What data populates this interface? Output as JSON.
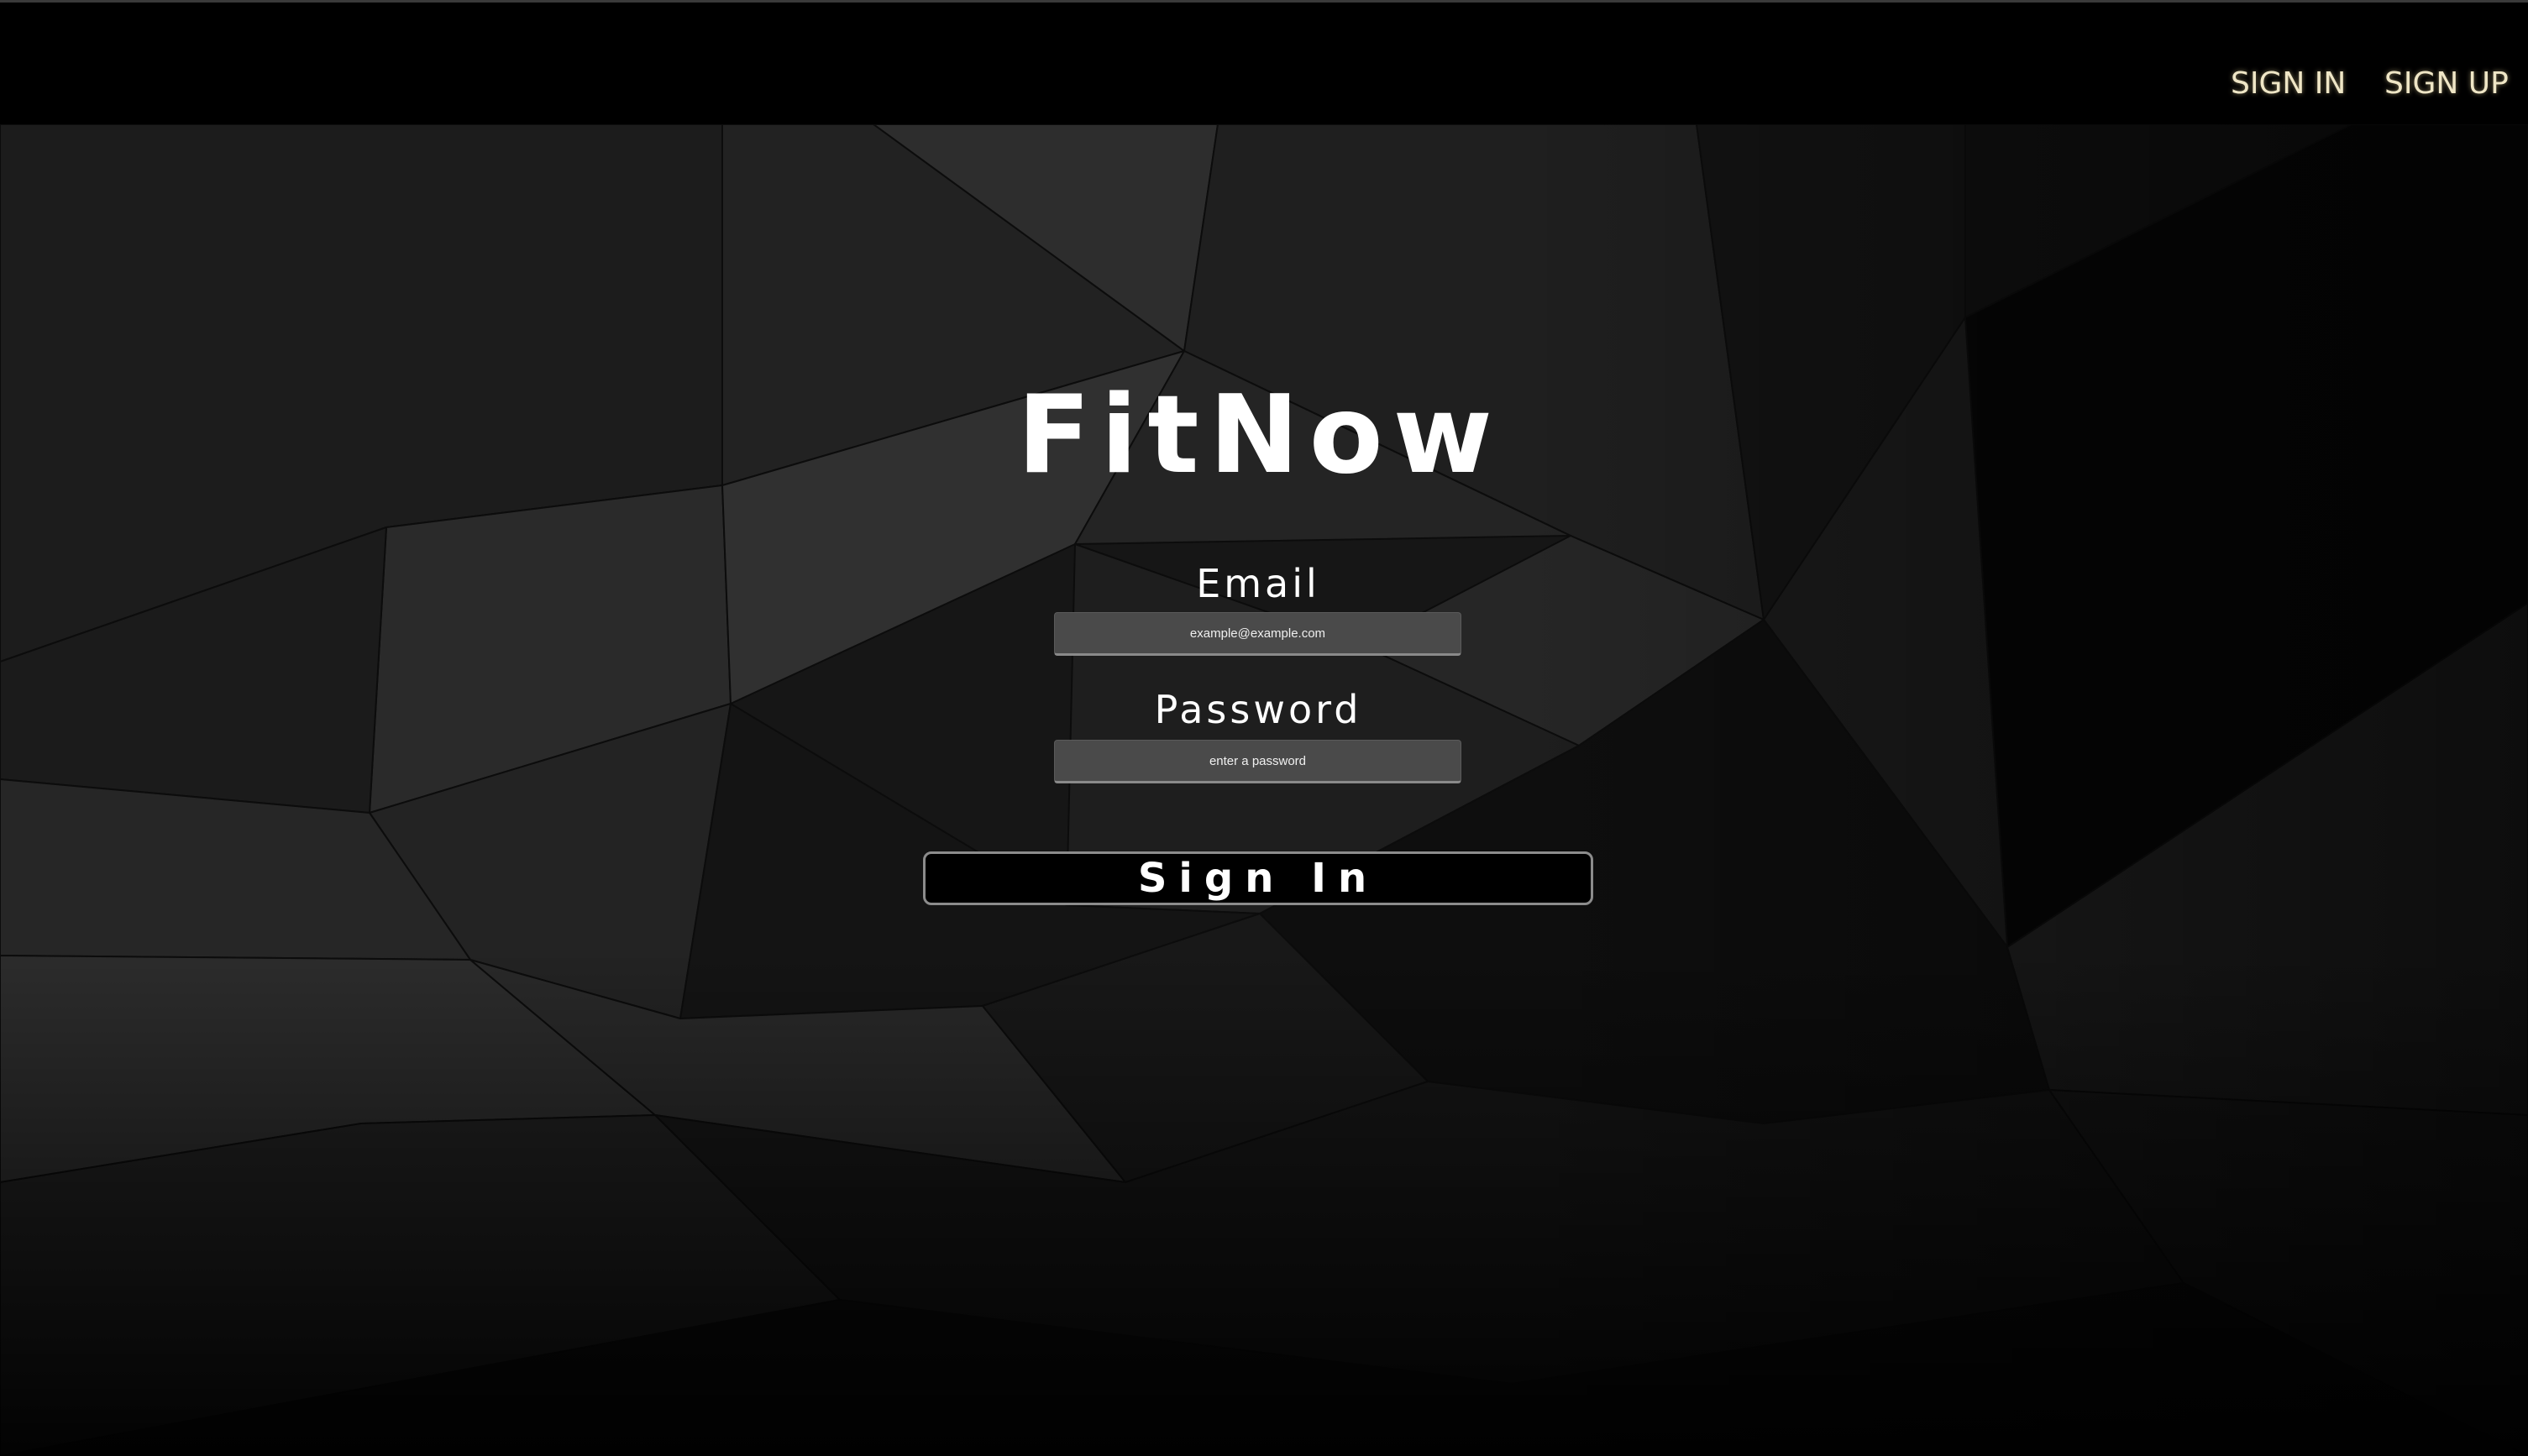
{
  "nav": {
    "sign_in": "SIGN IN",
    "sign_up": "SIGN UP"
  },
  "main": {
    "title": "FitNow",
    "email_label": "Email",
    "email_placeholder": "example@example.com",
    "password_label": "Password",
    "password_placeholder": "enter a password",
    "submit_label": "Sign In"
  },
  "colors": {
    "nav_link": "#efe6c6",
    "background": "#000000",
    "input_fill": "#4a4a4a",
    "text": "#ffffff"
  }
}
